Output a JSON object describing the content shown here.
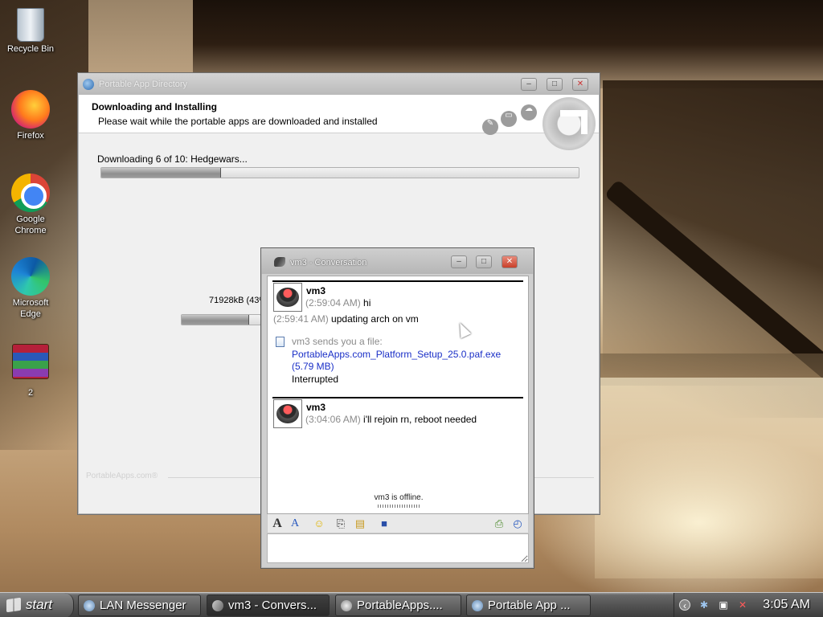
{
  "desktop": {
    "icons": [
      {
        "label": "Recycle Bin",
        "icon": "recycle-bin-icon"
      },
      {
        "label": "Firefox",
        "icon": "firefox-icon"
      },
      {
        "label": "Google Chrome",
        "icon": "chrome-icon"
      },
      {
        "label": "Microsoft Edge",
        "icon": "edge-icon"
      },
      {
        "label": "2",
        "icon": "winrar-archive-icon"
      }
    ]
  },
  "portable_window": {
    "title": "Portable App Directory",
    "heading": "Downloading and Installing",
    "subheading": "Please wait while the portable apps are downloaded and installed",
    "download_label": "Downloading 6 of 10: Hedgewars...",
    "overall_progress": 0.25,
    "file_progress_label": "71928kB (43%",
    "file_progress": 0.43,
    "footer": "PortableApps.com®"
  },
  "conversation": {
    "title": "vm3 - Conversation",
    "messages": [
      {
        "sender": "vm3",
        "lines": [
          {
            "time": "(2:59:04 AM)",
            "text": "hi"
          },
          {
            "time": "(2:59:41 AM)",
            "text": "updating arch on vm"
          }
        ],
        "file": {
          "intro": "vm3 sends you a file:",
          "name": "PortableApps.com_Platform_Setup_25.0.paf.exe",
          "size": "(5.79 MB)",
          "state": "Interrupted"
        }
      },
      {
        "sender": "vm3",
        "lines": [
          {
            "time": "(3:04:06 AM)",
            "text": "i'll rejoin rn, reboot needed"
          }
        ]
      }
    ],
    "status": "vm3 is offline.",
    "input_value": ""
  },
  "taskbar": {
    "start_label": "start",
    "tasks": [
      {
        "label": "LAN Messenger"
      },
      {
        "label": "vm3 - Convers..."
      },
      {
        "label": "PortableApps...."
      },
      {
        "label": "Portable App ..."
      }
    ],
    "clock": "3:05 AM"
  }
}
